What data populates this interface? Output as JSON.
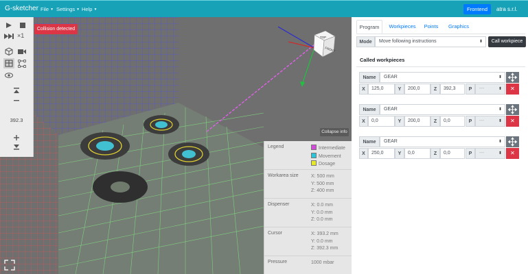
{
  "app": {
    "brand": "G-sketcher",
    "menu": [
      {
        "label": "File"
      },
      {
        "label": "Settings"
      },
      {
        "label": "Help"
      }
    ],
    "frontend_label": "Frontend",
    "company": "atra s.r.l."
  },
  "viewport": {
    "collision_badge": "Collision detected",
    "zoom_value": "392.3",
    "speed_label": "×1",
    "collapse_label": "Collapse info",
    "cube_top": "TOP",
    "cube_front": "FRONT",
    "info": {
      "legend_label": "Legend",
      "legend_items": [
        {
          "label": "Intermediate",
          "color": "#d04bd8"
        },
        {
          "label": "Movement",
          "color": "#2ec4d8"
        },
        {
          "label": "Dosage",
          "color": "#e8e82a"
        }
      ],
      "workarea_label": "Workarea size",
      "workarea": [
        "X: 500 mm",
        "Y: 500 mm",
        "Z: 400 mm"
      ],
      "dispenser_label": "Dispenser",
      "dispenser": [
        "X: 0.0 mm",
        "Y: 0.0 mm",
        "Z: 0.0 mm"
      ],
      "cursor_label": "Cursor",
      "cursor": [
        "X: 393.2 mm",
        "Y: 0.0 mm",
        "Z: 392.3 mm"
      ],
      "pressure_label": "Pressure",
      "pressure": "1000 mbar"
    }
  },
  "panel": {
    "tabs": [
      {
        "label": "Program",
        "active": true
      },
      {
        "label": "Workpieces",
        "active": false
      },
      {
        "label": "Points",
        "active": false
      },
      {
        "label": "Graphics",
        "active": false
      }
    ],
    "mode_label": "Mode",
    "mode_value": "Move following instructions",
    "call_button": "Call workpiece",
    "section_title": "Called workpieces",
    "field_labels": {
      "name": "Name",
      "x": "X",
      "y": "Y",
      "z": "Z",
      "p": "P"
    },
    "p_placeholder": "---",
    "workpieces": [
      {
        "name": "GEAR",
        "x": "125,0",
        "y": "200,0",
        "z": "392,3"
      },
      {
        "name": "GEAR",
        "x": "0,0",
        "y": "200,0",
        "z": "0,0"
      },
      {
        "name": "GEAR",
        "x": "250,0",
        "y": "0,0",
        "z": "0,0"
      }
    ]
  }
}
